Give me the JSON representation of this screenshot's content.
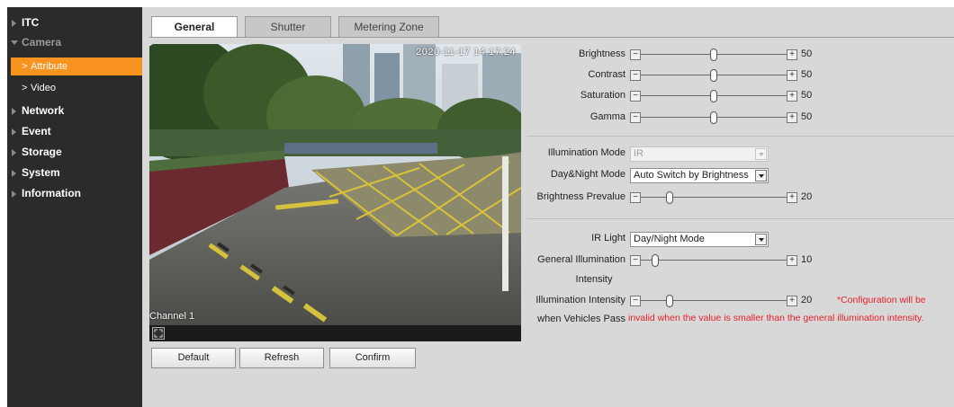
{
  "sidebar": {
    "items": [
      {
        "label": "ITC"
      },
      {
        "label": "Camera"
      },
      {
        "label": "Attribute"
      },
      {
        "label": "Video"
      },
      {
        "label": "Network"
      },
      {
        "label": "Event"
      },
      {
        "label": "Storage"
      },
      {
        "label": "System"
      },
      {
        "label": "Information"
      }
    ],
    "sub_arrow": ">"
  },
  "tabs": [
    {
      "label": "General",
      "active": true
    },
    {
      "label": "Shutter",
      "active": false
    },
    {
      "label": "Metering Zone",
      "active": false
    }
  ],
  "video": {
    "timestamp": "2020-11-17 14:17:24",
    "channel": "Channel 1"
  },
  "buttons": {
    "default": "Default",
    "refresh": "Refresh",
    "confirm": "Confirm"
  },
  "sliders": {
    "brightness": {
      "label": "Brightness",
      "value": "50",
      "fraction": 0.5
    },
    "contrast": {
      "label": "Contrast",
      "value": "50",
      "fraction": 0.5
    },
    "saturation": {
      "label": "Saturation",
      "value": "50",
      "fraction": 0.5
    },
    "gamma": {
      "label": "Gamma",
      "value": "50",
      "fraction": 0.5
    },
    "brightness_prevalue": {
      "label": "Brightness Prevalue",
      "value": "20",
      "fraction": 0.2
    },
    "general_illum": {
      "label_line1": "General Illumination",
      "label_line2": "Intensity",
      "value": "10",
      "fraction": 0.1
    },
    "vehicle_illum": {
      "label_line1": "Illumination Intensity",
      "label_line2": "when Vehicles Pass",
      "value": "20",
      "fraction": 0.2
    }
  },
  "slider_glyphs": {
    "minus": "−",
    "plus": "+"
  },
  "selects": {
    "illumination_mode": {
      "label": "Illumination Mode",
      "value": "IR",
      "disabled": true
    },
    "day_night_mode": {
      "label": "Day&Night Mode",
      "value": "Auto Switch by Brightness"
    },
    "ir_light": {
      "label": "IR Light",
      "value": "Day/Night Mode"
    }
  },
  "note": {
    "line1": "*Configuration will be",
    "line2": "invalid when the value is smaller than the general illumination intensity."
  },
  "colors": {
    "sidebar_bg": "#2b2b2b",
    "active_item": "#f7931e",
    "panel_bg": "#d8d8d8",
    "note_red": "#e8202a"
  },
  "icons": [
    "expand-triangle-icon",
    "collapse-triangle-icon",
    "chevron-right-icon",
    "fullscreen-icon",
    "dropdown-arrow-icon"
  ]
}
